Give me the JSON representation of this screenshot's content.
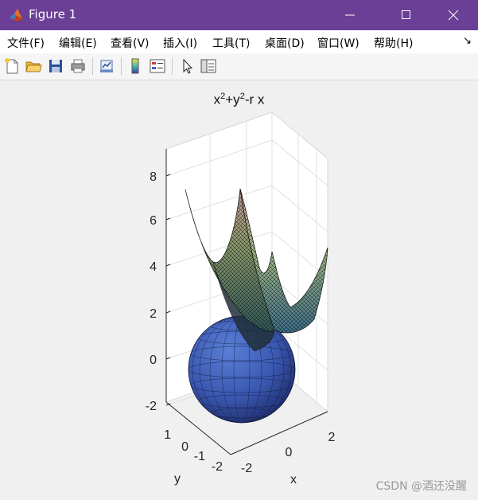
{
  "window": {
    "title": "Figure 1"
  },
  "menu": [
    {
      "label": "文件(F)"
    },
    {
      "label": "编辑(E)"
    },
    {
      "label": "查看(V)"
    },
    {
      "label": "插入(I)"
    },
    {
      "label": "工具(T)"
    },
    {
      "label": "桌面(D)"
    },
    {
      "label": "窗口(W)"
    },
    {
      "label": "帮助(H)"
    }
  ],
  "toolbar": [
    "new-figure-icon",
    "open-file-icon",
    "save-icon",
    "print-icon",
    "link-plot-icon",
    "colorbar-icon",
    "legend-icon",
    "pointer-icon",
    "property-editor-icon"
  ],
  "plot": {
    "title_base1": "x",
    "title_sup1": "2",
    "title_mid": "+y",
    "title_sup2": "2",
    "title_tail": "-r x",
    "zticks": [
      "8",
      "6",
      "4",
      "2",
      "0",
      "-2"
    ],
    "yticks": [
      "1",
      "0",
      "-1",
      "-2"
    ],
    "xticks": [
      "2",
      "0",
      "-2"
    ],
    "xlabel": "x",
    "ylabel": "y"
  },
  "watermark": "CSDN @酒还没醒",
  "colors": {
    "titlebar": "#6a3f95",
    "figure_bg": "#f0f0f0"
  }
}
